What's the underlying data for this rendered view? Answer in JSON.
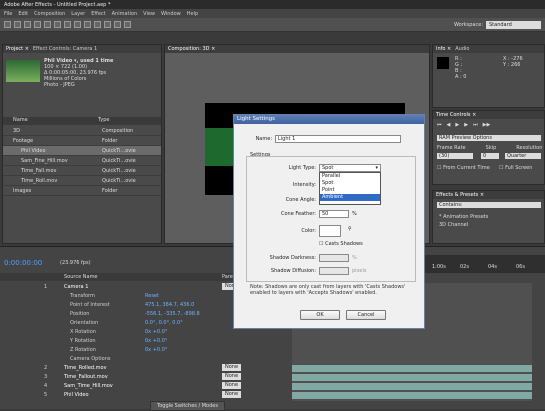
{
  "window": {
    "title": "Adobe After Effects - Untitled Project.aep *"
  },
  "menus": [
    "File",
    "Edit",
    "Composition",
    "Layer",
    "Effect",
    "Animation",
    "View",
    "Window",
    "Help"
  ],
  "workspace": {
    "label": "Workspace:",
    "value": "Standard"
  },
  "project_panel": {
    "tabs": [
      "Project ×",
      "Effect Controls: Camera 1"
    ],
    "info": [
      "Phil Video ▾, used 1 time",
      "100 × 722 (1.00)",
      "Δ 0:00:05:00, 23.976 fps",
      "Millions of Colors",
      "Photo - JPEG"
    ],
    "columns": [
      "Name",
      "Type"
    ],
    "rows": [
      {
        "name": "3D",
        "type": "Composition"
      },
      {
        "name": "Footage",
        "type": "Folder"
      },
      {
        "name": "Phil Video",
        "type": "QuickTi...ovie"
      },
      {
        "name": "Sam_Fine_Hill.mov",
        "type": "QuickTi...ovie"
      },
      {
        "name": "Time_Fall.mov",
        "type": "QuickTi...ovie"
      },
      {
        "name": "Time_Roll.mov",
        "type": "QuickTi...ovie"
      },
      {
        "name": "Images",
        "type": "Folder"
      }
    ]
  },
  "comp_panel": {
    "tab": "Composition: 3D ×"
  },
  "info_panel": {
    "tabs": [
      "Info ×",
      "Audio"
    ],
    "r": "R :",
    "g": "G :",
    "b": "B :",
    "a": "A : 0",
    "x": "X : -276",
    "y": "Y : 266"
  },
  "time_controls": {
    "tab": "Time Controls ×",
    "options": "RAM Preview Options",
    "frame_rate_label": "Frame Rate",
    "skip_label": "Skip",
    "resolution_label": "Resolution",
    "frame_rate": "(30)",
    "skip": "0",
    "resolution": "Quarter",
    "from_current": "From Current Time",
    "full_screen": "Full Screen"
  },
  "effects_panel": {
    "tab": "Effects & Presets ×",
    "search": "Contains:",
    "items": [
      "* Animation Presets",
      "3D Channel"
    ]
  },
  "dialog": {
    "title": "Light Settings",
    "name_label": "Name:",
    "name_value": "Light 1",
    "settings_label": "Settings",
    "light_type_label": "Light Type:",
    "light_type_value": "Spot",
    "intensity_label": "Intensity:",
    "cone_angle_label": "Cone Angle:",
    "cone_feather_label": "Cone Feather:",
    "cone_feather_value": "50",
    "pct": "%",
    "color_label": "Color:",
    "casts_shadows": "Casts Shadows",
    "shadow_darkness_label": "Shadow Darkness:",
    "shadow_diffusion_label": "Shadow Diffusion:",
    "pixels": "pixels",
    "note": "Note: Shadows are only cast from layers with 'Casts Shadows' enabled to layers with 'Accepts Shadows' enabled.",
    "ok": "OK",
    "cancel": "Cancel",
    "options": [
      "Parallel",
      "Spot",
      "Point",
      "Ambient"
    ]
  },
  "timeline": {
    "timecode": "0:00:00:00",
    "fps": "(23.976 fps)",
    "cols": [
      "Source Name",
      "Parent"
    ],
    "rows": [
      {
        "num": "1",
        "name": "Camera 1",
        "mode": "None"
      },
      {
        "name": "Transform",
        "val": "Reset"
      },
      {
        "name": "Point of Interest",
        "val": "475.1, 384.7, 436.0"
      },
      {
        "name": "Position",
        "val": "-556.1, -335.7, -898.8"
      },
      {
        "name": "Orientation",
        "val": "0.0°, 0.0°, 0.0°"
      },
      {
        "name": "X Rotation",
        "val": "0x +0.0°"
      },
      {
        "name": "Y Rotation",
        "val": "0x +0.0°"
      },
      {
        "name": "Z Rotation",
        "val": "0x +0.0°"
      },
      {
        "name": "Camera Options",
        "val": ""
      },
      {
        "num": "2",
        "name": "Time_Rolled.mov",
        "mode": "None"
      },
      {
        "num": "3",
        "name": "Time_Fallout.mov",
        "mode": "None"
      },
      {
        "num": "4",
        "name": "Sam_Time_Hill.mov",
        "mode": "None"
      },
      {
        "num": "5",
        "name": "Phil Video",
        "mode": "None"
      }
    ],
    "switch_label": "Toggle Switches / Modes",
    "ruler": [
      "1:00s",
      "02s",
      "04s",
      "06s"
    ]
  }
}
